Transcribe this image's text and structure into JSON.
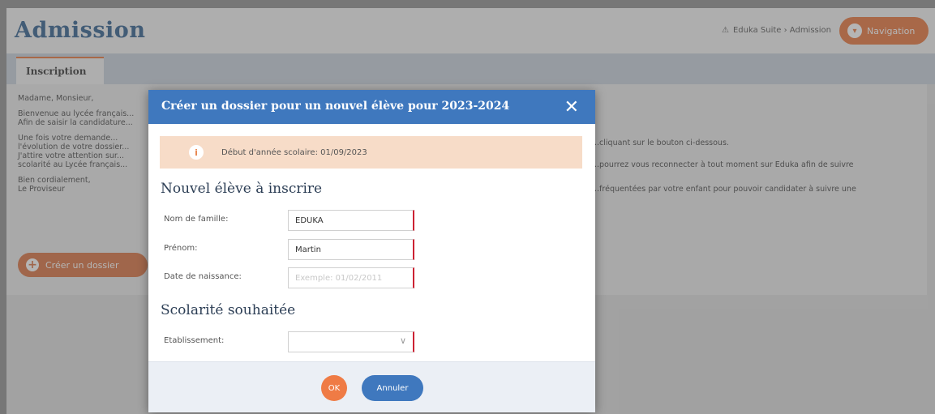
{
  "background": {
    "page_title": "Admission",
    "breadcrumb": "Eduka Suite › Admission",
    "navigation_label": "Navigation",
    "tab_label": "Inscription",
    "content_lines": {
      "greeting": "Madame, Monsieur,",
      "p1_a": "Bienvenue au lycée français...",
      "p1_b": "Afin de saisir la candidature...",
      "p2_a": "Une fois votre demande...",
      "p2_b": "l'évolution de votre dossier...",
      "p2_c": "J'attire votre attention sur...",
      "p2_d": "scolarité au Lycée français...",
      "closing_a": "Bien cordialement,",
      "closing_b": "Le Proviseur",
      "right_1": "...cliquant sur le bouton ci-dessous.",
      "right_2": "...pourrez vous reconnecter à tout moment sur Eduka afin de suivre",
      "right_3": "...fréquentées par votre enfant pour pouvoir candidater à suivre une"
    },
    "create_button_label": "Créer un dossier"
  },
  "modal": {
    "title": "Créer un dossier pour un nouvel élève pour 2023-2024",
    "info_text": "Début d'année scolaire: 01/09/2023",
    "section_student": "Nouvel élève à inscrire",
    "section_schooling": "Scolarité souhaitée",
    "fields": {
      "last_name_label": "Nom de famille:",
      "last_name_value": "EDUKA",
      "first_name_label": "Prénom:",
      "first_name_value": "Martin",
      "birth_date_label": "Date de naissance:",
      "birth_date_placeholder": "Exemple: 01/02/2011",
      "school_label": "Etablissement:"
    },
    "ok_label": "OK",
    "cancel_label": "Annuler"
  },
  "colors": {
    "accent_orange": "#e8733a",
    "modal_header_blue": "#3f78be",
    "info_box": "#f7dcc8",
    "required_marker": "#cc2233"
  },
  "icons": [
    "warning-icon",
    "navigation-icon",
    "plus-icon",
    "close-icon",
    "info-icon",
    "chevron-down-icon"
  ]
}
